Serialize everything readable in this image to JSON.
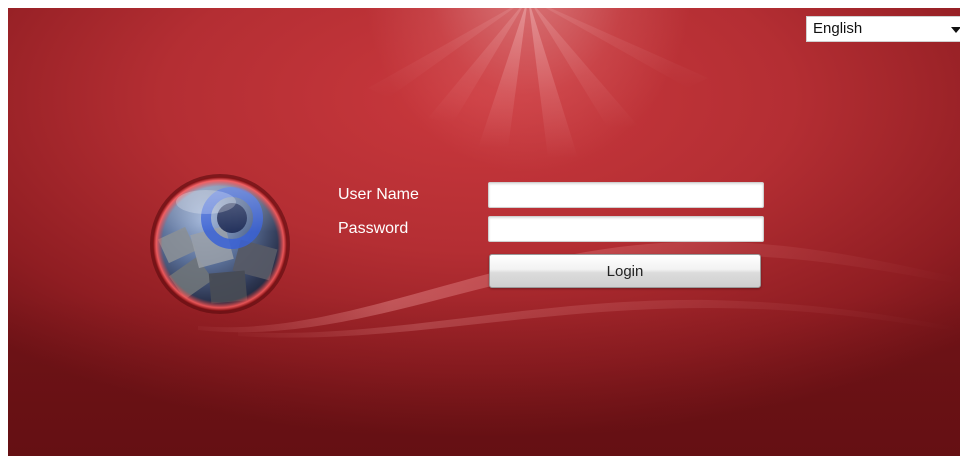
{
  "language_select": {
    "selected": "English"
  },
  "login_form": {
    "username_label": "User Name",
    "password_label": "Password",
    "username_value": "",
    "password_value": "",
    "login_button": "Login"
  },
  "colors": {
    "background_red": "#b42e33",
    "dark_red": "#701317",
    "label_text": "#ffffff"
  },
  "icons": {
    "logo": "camera-globe-logo",
    "dropdown": "caret-down-icon"
  }
}
